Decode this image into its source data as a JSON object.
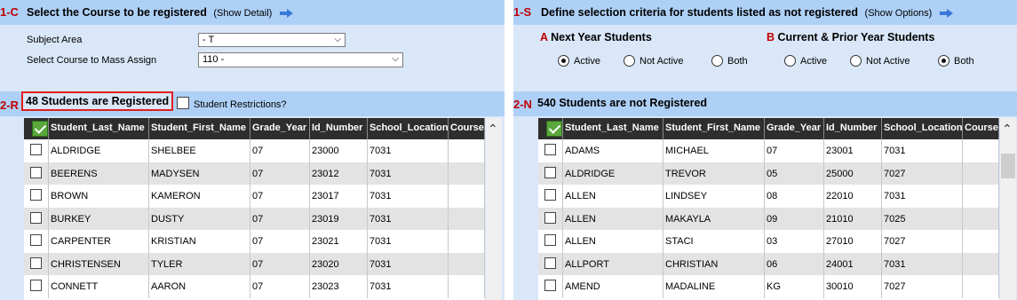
{
  "left": {
    "header": {
      "num": "1-C",
      "title": "Select the Course to be registered",
      "link": "(Show Detail)"
    },
    "subject_area": {
      "label": "Subject Area",
      "value": "- T"
    },
    "course": {
      "label": "Select Course to Mass Assign",
      "value": "110 -"
    },
    "registered": {
      "num": "2-R",
      "count_label": "48 Students are Registered",
      "restrictions_label": "Student Restrictions?",
      "columns": [
        "Student_Last_Name",
        "Student_First_Name",
        "Grade_Year",
        "Id_Number",
        "School_Location",
        "Course"
      ],
      "rows": [
        [
          "ALDRIDGE",
          "SHELBEE",
          "07",
          "23000",
          "7031"
        ],
        [
          "BEERENS",
          "MADYSEN",
          "07",
          "23012",
          "7031"
        ],
        [
          "BROWN",
          "KAMERON",
          "07",
          "23017",
          "7031"
        ],
        [
          "BURKEY",
          "DUSTY",
          "07",
          "23019",
          "7031"
        ],
        [
          "CARPENTER",
          "KRISTIAN",
          "07",
          "23021",
          "7031"
        ],
        [
          "CHRISTENSEN",
          "TYLER",
          "07",
          "23020",
          "7031"
        ],
        [
          "CONNETT",
          "AARON",
          "07",
          "23023",
          "7031"
        ]
      ]
    }
  },
  "right": {
    "header": {
      "num": "1-S",
      "title": "Define selection criteria for students listed as not registered",
      "link": "(Show Options)"
    },
    "next_year": {
      "letter": "A",
      "title": "Next Year Students",
      "options": [
        "Active",
        "Not Active",
        "Both"
      ],
      "selected": "Active"
    },
    "current_prior": {
      "letter": "B",
      "title": "Current & Prior Year Students",
      "options": [
        "Active",
        "Not Active",
        "Both"
      ],
      "selected": "Both"
    },
    "not_registered": {
      "num": "2-N",
      "count_label": "540 Students are not Registered",
      "columns": [
        "Student_Last_Name",
        "Student_First_Name",
        "Grade_Year",
        "Id_Number",
        "School_Location",
        "Course"
      ],
      "rows": [
        [
          "ADAMS",
          "MICHAEL",
          "07",
          "23001",
          "7031"
        ],
        [
          "ALDRIDGE",
          "TREVOR",
          "05",
          "25000",
          "7027"
        ],
        [
          "ALLEN",
          "LINDSEY",
          "08",
          "22010",
          "7031"
        ],
        [
          "ALLEN",
          "MAKAYLA",
          "09",
          "21010",
          "7025"
        ],
        [
          "ALLEN",
          "STACI",
          "03",
          "27010",
          "7027"
        ],
        [
          "ALLPORT",
          "CHRISTIAN",
          "06",
          "24001",
          "7031"
        ],
        [
          "AMEND",
          "MADALINE",
          "KG",
          "30010",
          "7027"
        ]
      ]
    }
  },
  "colors": {
    "header_bg": "#aed0f6",
    "panel_bg": "#d9e7f8",
    "accent_red": "#c00000",
    "grid_header": "#2e2e2e"
  }
}
